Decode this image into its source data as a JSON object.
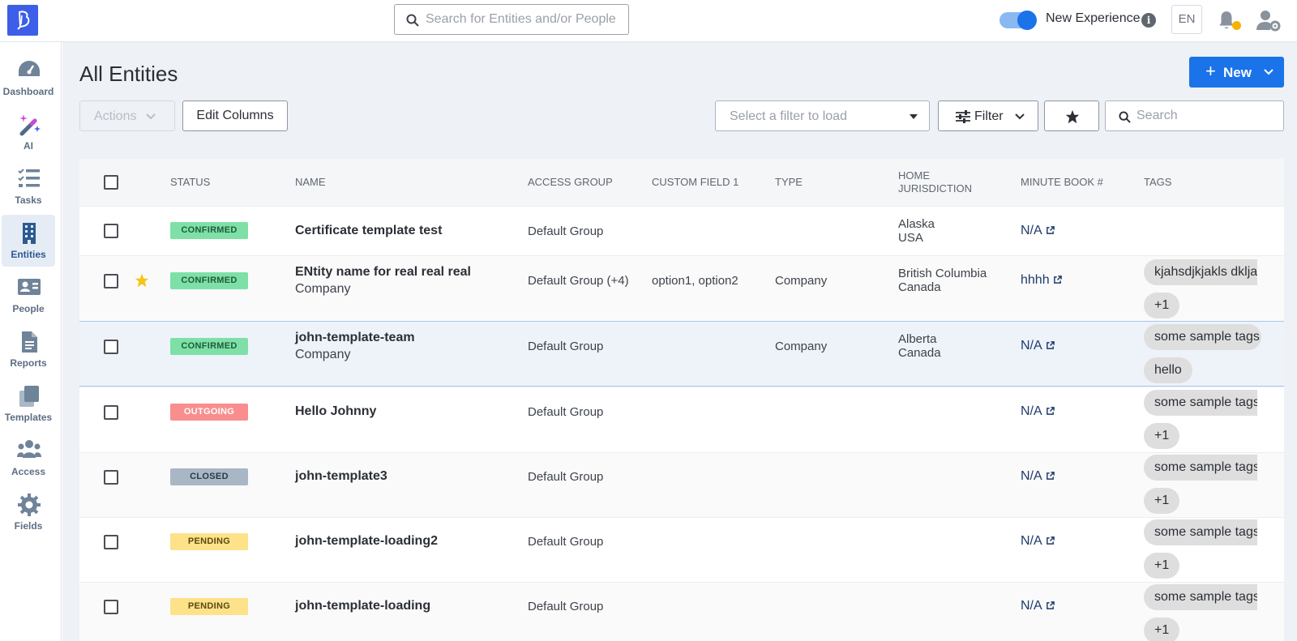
{
  "topbar": {
    "search_placeholder": "Search for Entities and/or People",
    "new_experience_label": "New Experience",
    "new_experience_on": true,
    "info_glyph": "i",
    "language": "EN"
  },
  "sidebar": {
    "items": [
      {
        "label": "Dashboard",
        "icon": "dashboard-icon",
        "active": false
      },
      {
        "label": "AI",
        "icon": "ai-wand-icon",
        "active": false
      },
      {
        "label": "Tasks",
        "icon": "tasks-icon",
        "active": false
      },
      {
        "label": "Entities",
        "icon": "entities-icon",
        "active": true
      },
      {
        "label": "People",
        "icon": "people-icon",
        "active": false
      },
      {
        "label": "Reports",
        "icon": "reports-icon",
        "active": false
      },
      {
        "label": "Templates",
        "icon": "templates-icon",
        "active": false
      },
      {
        "label": "Access",
        "icon": "access-icon",
        "active": false
      },
      {
        "label": "Fields",
        "icon": "fields-icon",
        "active": false
      }
    ]
  },
  "main": {
    "title": "All Entities",
    "new_button": "New",
    "new_button_plus": "+",
    "actions_button": "Actions",
    "edit_columns_button": "Edit Columns",
    "filter_select_placeholder": "Select a filter to load",
    "filter_button": "Filter",
    "search_placeholder": "Search"
  },
  "table": {
    "columns": {
      "status": "STATUS",
      "name": "NAME",
      "access_group": "ACCESS GROUP",
      "custom_field_1": "CUSTOM FIELD 1",
      "type": "TYPE",
      "home_jurisdiction_1": "HOME",
      "home_jurisdiction_2": "JURISDICTION",
      "minute_book": "MINUTE BOOK #",
      "tags": "TAGS"
    },
    "rows": [
      {
        "status": "CONFIRMED",
        "name": "Certificate template test",
        "sub": "",
        "access_group": "Default Group",
        "custom": "",
        "type": "",
        "jur1": "Alaska",
        "jur2": "USA",
        "minute_book": "N/A",
        "tag1": "",
        "tag2": "",
        "starred": false
      },
      {
        "status": "CONFIRMED",
        "name": "ENtity name for real real real",
        "sub": "Company",
        "access_group": "Default Group (+4)",
        "custom": "option1, option2",
        "type": "Company",
        "jur1": "British Columbia",
        "jur2": "Canada",
        "minute_book": "hhhh",
        "tag1": "kjahsdjkjakls dklja",
        "tag2": "+1",
        "starred": true
      },
      {
        "status": "CONFIRMED",
        "name": "john-template-team",
        "sub": "Company",
        "access_group": "Default Group",
        "custom": "",
        "type": "Company",
        "jur1": "Alberta",
        "jur2": "Canada",
        "minute_book": "N/A",
        "tag1": "some sample tags",
        "tag2": "hello",
        "starred": false
      },
      {
        "status": "OUTGOING",
        "name": "Hello Johnny",
        "sub": "",
        "access_group": "Default Group",
        "custom": "",
        "type": "",
        "jur1": "",
        "jur2": "",
        "minute_book": "N/A",
        "tag1": "some sample tags",
        "tag2": "+1",
        "starred": false
      },
      {
        "status": "CLOSED",
        "name": "john-template3",
        "sub": "",
        "access_group": "Default Group",
        "custom": "",
        "type": "",
        "jur1": "",
        "jur2": "",
        "minute_book": "N/A",
        "tag1": "some sample tags",
        "tag2": "+1",
        "starred": false
      },
      {
        "status": "PENDING",
        "name": "john-template-loading2",
        "sub": "",
        "access_group": "Default Group",
        "custom": "",
        "type": "",
        "jur1": "",
        "jur2": "",
        "minute_book": "N/A",
        "tag1": "some sample tags",
        "tag2": "+1",
        "starred": false
      },
      {
        "status": "PENDING",
        "name": "john-template-loading",
        "sub": "",
        "access_group": "Default Group",
        "custom": "",
        "type": "",
        "jur1": "",
        "jur2": "",
        "minute_book": "N/A",
        "tag1": "some sample tags",
        "tag2": "+1",
        "starred": false
      }
    ]
  },
  "colors": {
    "brand": "#3c5ee8",
    "primary": "#1a73e8",
    "confirmed": "#7ee0a7",
    "outgoing": "#f98e8e",
    "closed": "#a8b6c6",
    "pending": "#fde28a",
    "star": "#f5c518"
  }
}
